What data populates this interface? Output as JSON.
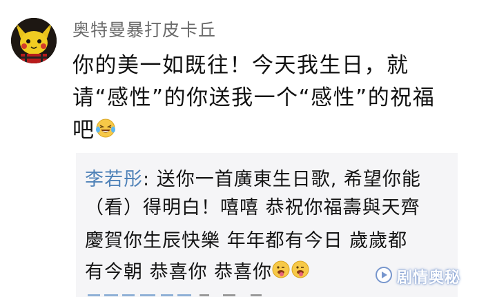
{
  "comment": {
    "username": "奥特曼暴打皮卡丘",
    "lines": [
      "你的美一如既往！今天我生日，就",
      "请“感性”的你送我一个“感性”的祝福",
      "吧"
    ],
    "emoji_icon": "laughing-tears-emoji"
  },
  "reply": {
    "author": "李若彤",
    "colon": ":",
    "lines": [
      " 送你一首廣東生日歌, 希望你能",
      "（看）得明白！嘻嘻 恭祝你福壽與天齊",
      "慶賀你生辰快樂 年年都有今日 歲歲都",
      "有今朝 恭喜你 恭喜你"
    ],
    "emoji_icon": "tongue-out-wink-emoji"
  },
  "watermark": {
    "text": "剧情奥秘",
    "icon": "play-logo-icon"
  },
  "colors": {
    "username": "#6b6b6b",
    "reply_author": "#4f82b8",
    "reply_bg": "#f5f5f7",
    "text": "#111111"
  }
}
